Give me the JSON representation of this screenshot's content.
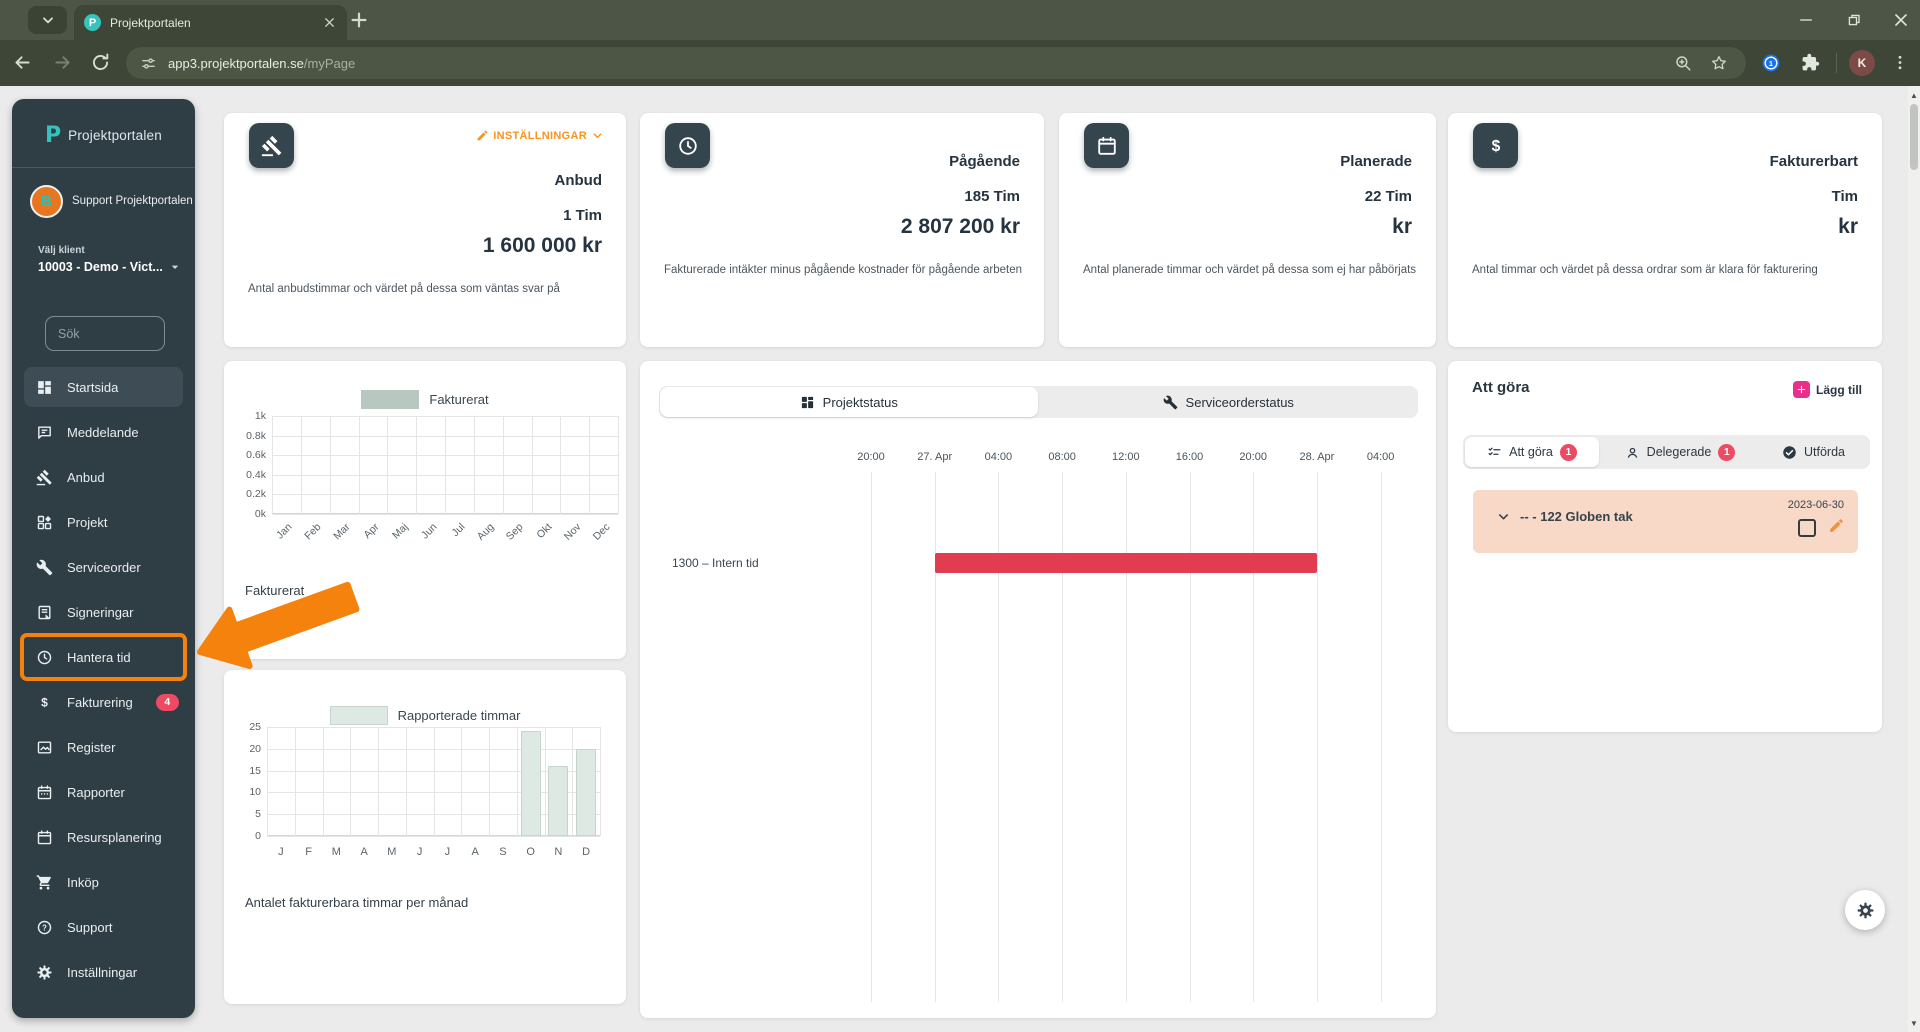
{
  "browser": {
    "tab_title": "Projektportalen",
    "favicon_letter": "P",
    "url_host": "app3.projektportalen.se",
    "url_path": "/myPage",
    "profile_initial": "K"
  },
  "sidebar": {
    "brand": "Projektportalen",
    "user": {
      "initial": "B",
      "name": "Support Projektportalen"
    },
    "client": {
      "label": "Välj klient",
      "value": "10003 - Demo - Vict..."
    },
    "search_placeholder": "Sök",
    "items": [
      {
        "label": "Startsida",
        "icon": "dashboard",
        "active": true
      },
      {
        "label": "Meddelande",
        "icon": "message"
      },
      {
        "label": "Anbud",
        "icon": "gavel"
      },
      {
        "label": "Projekt",
        "icon": "projects"
      },
      {
        "label": "Serviceorder",
        "icon": "wrench"
      },
      {
        "label": "Signeringar",
        "icon": "document"
      },
      {
        "label": "Hantera tid",
        "icon": "clock",
        "highlighted": true
      },
      {
        "label": "Fakturering",
        "icon": "dollar",
        "badge": "4"
      },
      {
        "label": "Register",
        "icon": "image"
      },
      {
        "label": "Rapporter",
        "icon": "calendar-dots"
      },
      {
        "label": "Resursplanering",
        "icon": "calendar"
      },
      {
        "label": "Inköp",
        "icon": "cart"
      },
      {
        "label": "Support",
        "icon": "help"
      },
      {
        "label": "Inställningar",
        "icon": "gear"
      }
    ]
  },
  "annotation": {
    "type": "arrow-and-box",
    "target": "Hantera tid",
    "color": "#f5820d"
  },
  "stat_cards": [
    {
      "icon": "gavel",
      "settings_label": "INSTÄLLNINGAR",
      "title": "Anbud",
      "hours": "1 Tim",
      "amount": "1 600 000 kr",
      "caption": "Antal anbudstimmar och värdet på dessa som väntas svar på"
    },
    {
      "icon": "clock",
      "title": "Pågående",
      "hours": "185 Tim",
      "amount": "2 807 200 kr",
      "caption": "Fakturerade intäkter minus pågående kostnader för pågående arbeten"
    },
    {
      "icon": "calendar",
      "title": "Planerade",
      "hours": "22 Tim",
      "amount": "kr",
      "caption": "Antal planerade timmar och värdet på dessa som ej har påbörjats"
    },
    {
      "icon": "dollar",
      "title": "Fakturerbart",
      "hours": "Tim",
      "amount": "kr",
      "caption": "Antal timmar och värdet på dessa ordrar som är klara för fakturering"
    }
  ],
  "chart_data": [
    {
      "type": "bar",
      "legend": "Fakturerat",
      "categories": [
        "Jan",
        "Feb",
        "Mar",
        "Apr",
        "Maj",
        "Jun",
        "Jul",
        "Aug",
        "Sep",
        "Okt",
        "Nov",
        "Dec"
      ],
      "values": [
        0,
        0,
        0,
        0,
        0,
        0,
        0,
        0,
        0,
        0,
        0,
        0
      ],
      "ylim": [
        0,
        1000
      ],
      "yticks": [
        "1k",
        "0.8k",
        "0.6k",
        "0.4k",
        "0.2k",
        "0k"
      ],
      "grid": true,
      "legend_position": "top",
      "bar_color": "#b7c8c1",
      "caption": "Fakturerat"
    },
    {
      "type": "bar",
      "legend": "Rapporterade timmar",
      "categories": [
        "J",
        "F",
        "M",
        "A",
        "M",
        "J",
        "J",
        "A",
        "S",
        "O",
        "N",
        "D"
      ],
      "values": [
        0,
        0,
        0,
        0,
        0,
        0,
        0,
        0,
        0,
        24,
        16,
        20
      ],
      "ylim": [
        0,
        25
      ],
      "yticks": [
        "25",
        "20",
        "15",
        "10",
        "5",
        "0"
      ],
      "grid": true,
      "legend_position": "top",
      "bar_color": "#dfe9e3",
      "bar_border": "#c6d6ce",
      "caption": "Antalet fakturerbara timmar per månad"
    },
    {
      "type": "gantt",
      "tabs": [
        {
          "label": "Projektstatus",
          "icon": "grid-small",
          "active": true
        },
        {
          "label": "Serviceorderstatus",
          "icon": "wrench",
          "active": false
        }
      ],
      "time_ticks": [
        "20:00",
        "27. Apr",
        "04:00",
        "08:00",
        "12:00",
        "16:00",
        "20:00",
        "28. Apr",
        "04:00"
      ],
      "rows": [
        {
          "label": "1300 – Intern tid",
          "bar": {
            "start_tick": 1,
            "end_tick": 7,
            "color": "#e23c50"
          }
        }
      ]
    }
  ],
  "todo": {
    "title": "Att göra",
    "add_button": "Lägg till",
    "tabs": [
      {
        "label": "Att göra",
        "icon": "checklist",
        "badge": "1",
        "active": true
      },
      {
        "label": "Delegerade",
        "icon": "person",
        "badge": "1",
        "active": false
      },
      {
        "label": "Utförda",
        "icon": "check-circle",
        "badge": "",
        "active": false
      }
    ],
    "tasks": [
      {
        "title": "-- - 122 Globen tak",
        "date": "2023-06-30"
      }
    ]
  },
  "colors": {
    "accent_orange": "#f5820d",
    "badge_red": "#f04a62",
    "gantt_red": "#e23c50",
    "add_pink": "#e72f8c",
    "sidebar_bg": "#2f3e45",
    "brand_teal": "#35c4bd"
  }
}
